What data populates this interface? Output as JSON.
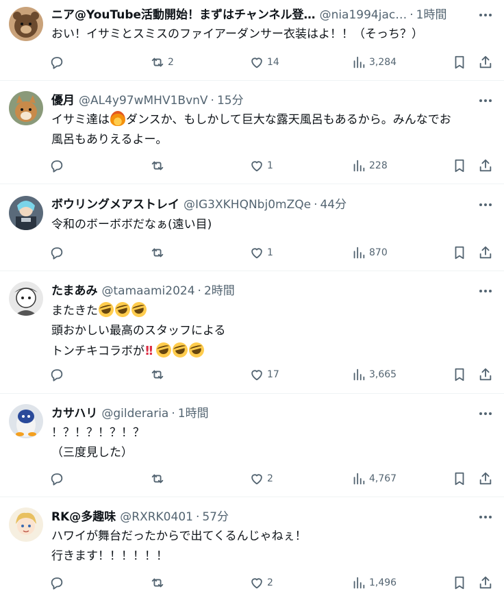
{
  "replies": [
    {
      "name": "ニア@YouTube活動開始！まずはチャンネル登…",
      "handle": "@nia1994jac…",
      "time": "1時間",
      "lines": [
        "おい！イサミとスミスのファイアーダンサー衣装はよ！！（そっち？）"
      ],
      "stats": {
        "replies": "",
        "retweets": "2",
        "likes": "14",
        "views": "3,284"
      },
      "avatar_colors": [
        "#6b4a2e",
        "#d8b48a"
      ]
    },
    {
      "name": "優月",
      "handle": "@AL4y97wMHV1BvnV",
      "time": "15分",
      "lines": [
        "イサミ達は",
        "ダンスか、もしかして巨大な露天風呂もあるから。みんなでお",
        "風呂もありえるよー。"
      ],
      "stats": {
        "replies": "",
        "retweets": "",
        "likes": "1",
        "views": "228"
      },
      "avatar_colors": [
        "#7a8a6a",
        "#c88a4a"
      ]
    },
    {
      "name": "ボウリングメアストレイ",
      "handle": "@IG3XKHQNbj0mZQe",
      "time": "44分",
      "lines": [
        "令和のボーボボだなぁ(遠い目)"
      ],
      "stats": {
        "replies": "",
        "retweets": "",
        "likes": "1",
        "views": "870"
      },
      "avatar_colors": [
        "#3a4a5a",
        "#7ad4e8"
      ]
    },
    {
      "name": "たまあみ",
      "handle": "@tamaami2024",
      "time": "2時間",
      "lines": [
        "またきた",
        "頭おかしい最高のスタッフによる",
        "トンチキコラボが"
      ],
      "stats": {
        "replies": "",
        "retweets": "",
        "likes": "17",
        "views": "3,665"
      },
      "avatar_colors": [
        "#e8e8e8",
        "#333333"
      ]
    },
    {
      "name": "カサハリ",
      "handle": "@gilderaria",
      "time": "1時間",
      "lines": [
        "！？！？！？！？",
        "（三度見した）"
      ],
      "stats": {
        "replies": "",
        "retweets": "",
        "likes": "2",
        "views": "4,767"
      },
      "avatar_colors": [
        "#2a4a9a",
        "#f0f0f0"
      ]
    },
    {
      "name": "RK@多趣味",
      "handle": "@RXRK0401",
      "time": "57分",
      "lines": [
        "ハワイが舞台だったからで出てくるんじゃねぇ！",
        "行きます！！！！！！"
      ],
      "stats": {
        "replies": "",
        "retweets": "",
        "likes": "2",
        "views": "1,496"
      },
      "avatar_colors": [
        "#f4e0b0",
        "#e8c060"
      ]
    }
  ],
  "icons": {
    "reply": "reply-icon",
    "retweet": "retweet-icon",
    "like": "heart-icon",
    "views": "views-icon",
    "bookmark": "bookmark-icon",
    "share": "share-icon",
    "more": "more-icon"
  },
  "separator": "·"
}
